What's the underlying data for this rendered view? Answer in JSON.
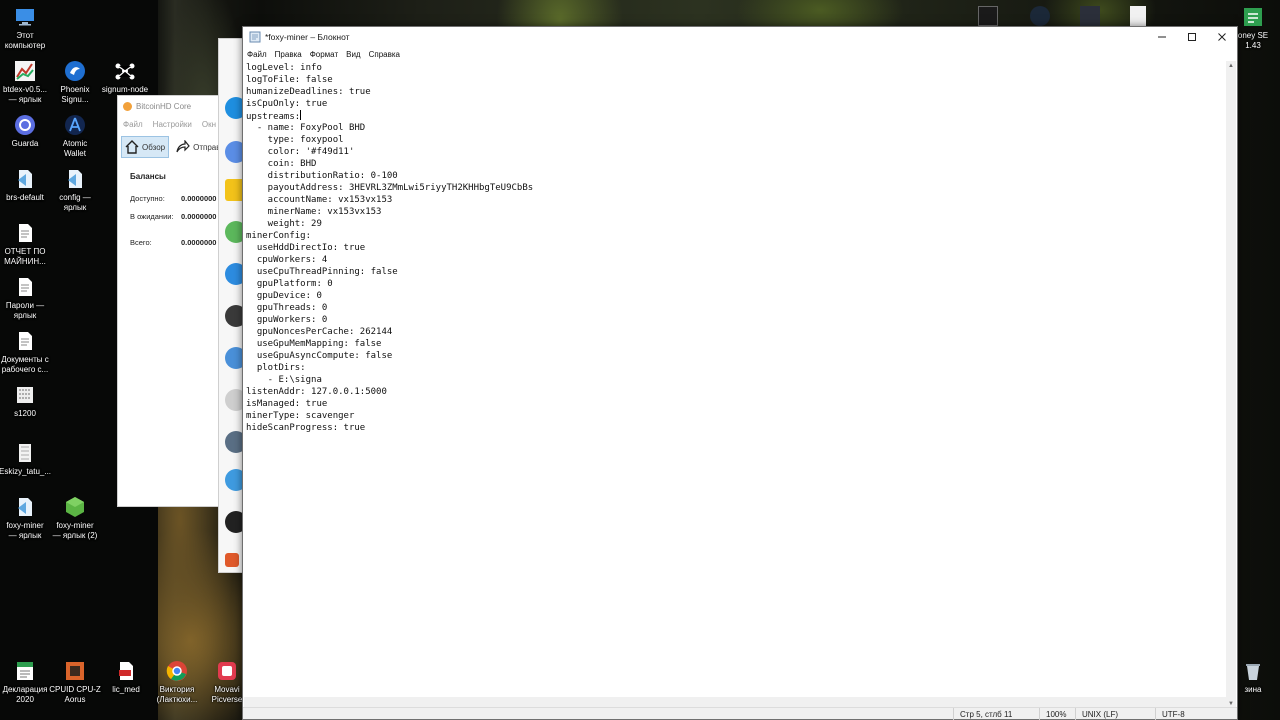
{
  "desktop": {
    "icons": [
      {
        "label": "Этот\nкомпьютер",
        "icon": "monitor-icon"
      },
      {
        "label": "btdex-v0.5...\n— ярлык",
        "icon": "btdex-icon"
      },
      {
        "label": "Phoenix\nSignu...",
        "icon": "phoenix-icon"
      },
      {
        "label": "signum-node",
        "icon": "signum-icon"
      },
      {
        "label": "Guarda",
        "icon": "guarda-icon"
      },
      {
        "label": "Atomic\nWallet",
        "icon": "atomic-icon"
      },
      {
        "label": "brs-default",
        "icon": "shortcut-icon"
      },
      {
        "label": "config —\nярлык",
        "icon": "shortcut-icon"
      },
      {
        "label": "ОТЧЕТ ПО\nМАЙНИН...",
        "icon": "document-icon"
      },
      {
        "label": "Пароли —\nярлык",
        "icon": "document-icon"
      },
      {
        "label": "Документы с\nрабочего с...",
        "icon": "document-icon"
      },
      {
        "label": "s1200",
        "icon": "image-icon"
      },
      {
        "label": "Eskizy_tatu_...",
        "icon": "image-icon"
      },
      {
        "label": "foxy-miner\n— ярлык",
        "icon": "shortcut-icon"
      },
      {
        "label": "foxy-miner\n— ярлык (2)",
        "icon": "foxy-icon"
      },
      {
        "label": "Декларация\n2020",
        "icon": "declaration-icon"
      },
      {
        "label": "CPUID CPU-Z\nAorus",
        "icon": "cpuz-icon"
      },
      {
        "label": "lic_med",
        "icon": "pdf-icon"
      },
      {
        "label": "Виктория\n(Лактюхи...",
        "icon": "chrome-icon"
      },
      {
        "label": "Movavi\nPicverse",
        "icon": "movavi-icon"
      },
      {
        "label": "oney SE\n1.43",
        "icon": "app-icon"
      },
      {
        "label": "зина",
        "icon": "trash-icon"
      }
    ]
  },
  "btchd": {
    "title": "BitcoinHD Core",
    "menu": [
      "Файл",
      "Настройки",
      "Окн"
    ],
    "tabs": [
      "Обзор",
      "Отправи"
    ],
    "balances_title": "Балансы",
    "rows": [
      {
        "key": "Доступно:",
        "value": "0.0000000"
      },
      {
        "key": "В ожидании:",
        "value": "0.0000000"
      },
      {
        "key": "Всего:",
        "value": "0.0000000"
      }
    ]
  },
  "notepad": {
    "title": "*foxy-miner – Блокнот",
    "menu": [
      "Файл",
      "Правка",
      "Формат",
      "Вид",
      "Справка"
    ],
    "lines": [
      "logLevel: info",
      "logToFile: false",
      "humanizeDeadlines: true",
      "isCpuOnly: true",
      "upstreams:",
      "  - name: FoxyPool BHD",
      "    type: foxypool",
      "    color: '#f49d11'",
      "    coin: BHD",
      "    distributionRatio: 0-100",
      "    payoutAddress: 3HEVRL3ZMmLwi5riyyTH2KHHbgTeU9CbBs",
      "    accountName: vx153vx153",
      "    minerName: vx153vx153",
      "    weight: 29",
      "minerConfig:",
      "  useHddDirectIo: true",
      "  cpuWorkers: 4",
      "  useCpuThreadPinning: false",
      "  gpuPlatform: 0",
      "  gpuDevice: 0",
      "  gpuThreads: 0",
      "  gpuWorkers: 0",
      "  gpuNoncesPerCache: 262144",
      "  useGpuMemMapping: false",
      "  useGpuAsyncCompute: false",
      "  plotDirs:",
      "    - E:\\signa",
      "listenAddr: 127.0.0.1:5000",
      "isManaged: true",
      "minerType: scavenger",
      "hideScanProgress: true"
    ],
    "status": {
      "position": "Стр 5, стлб 11",
      "zoom": "100%",
      "line_ending": "UNIX (LF)",
      "encoding": "UTF-8"
    }
  }
}
